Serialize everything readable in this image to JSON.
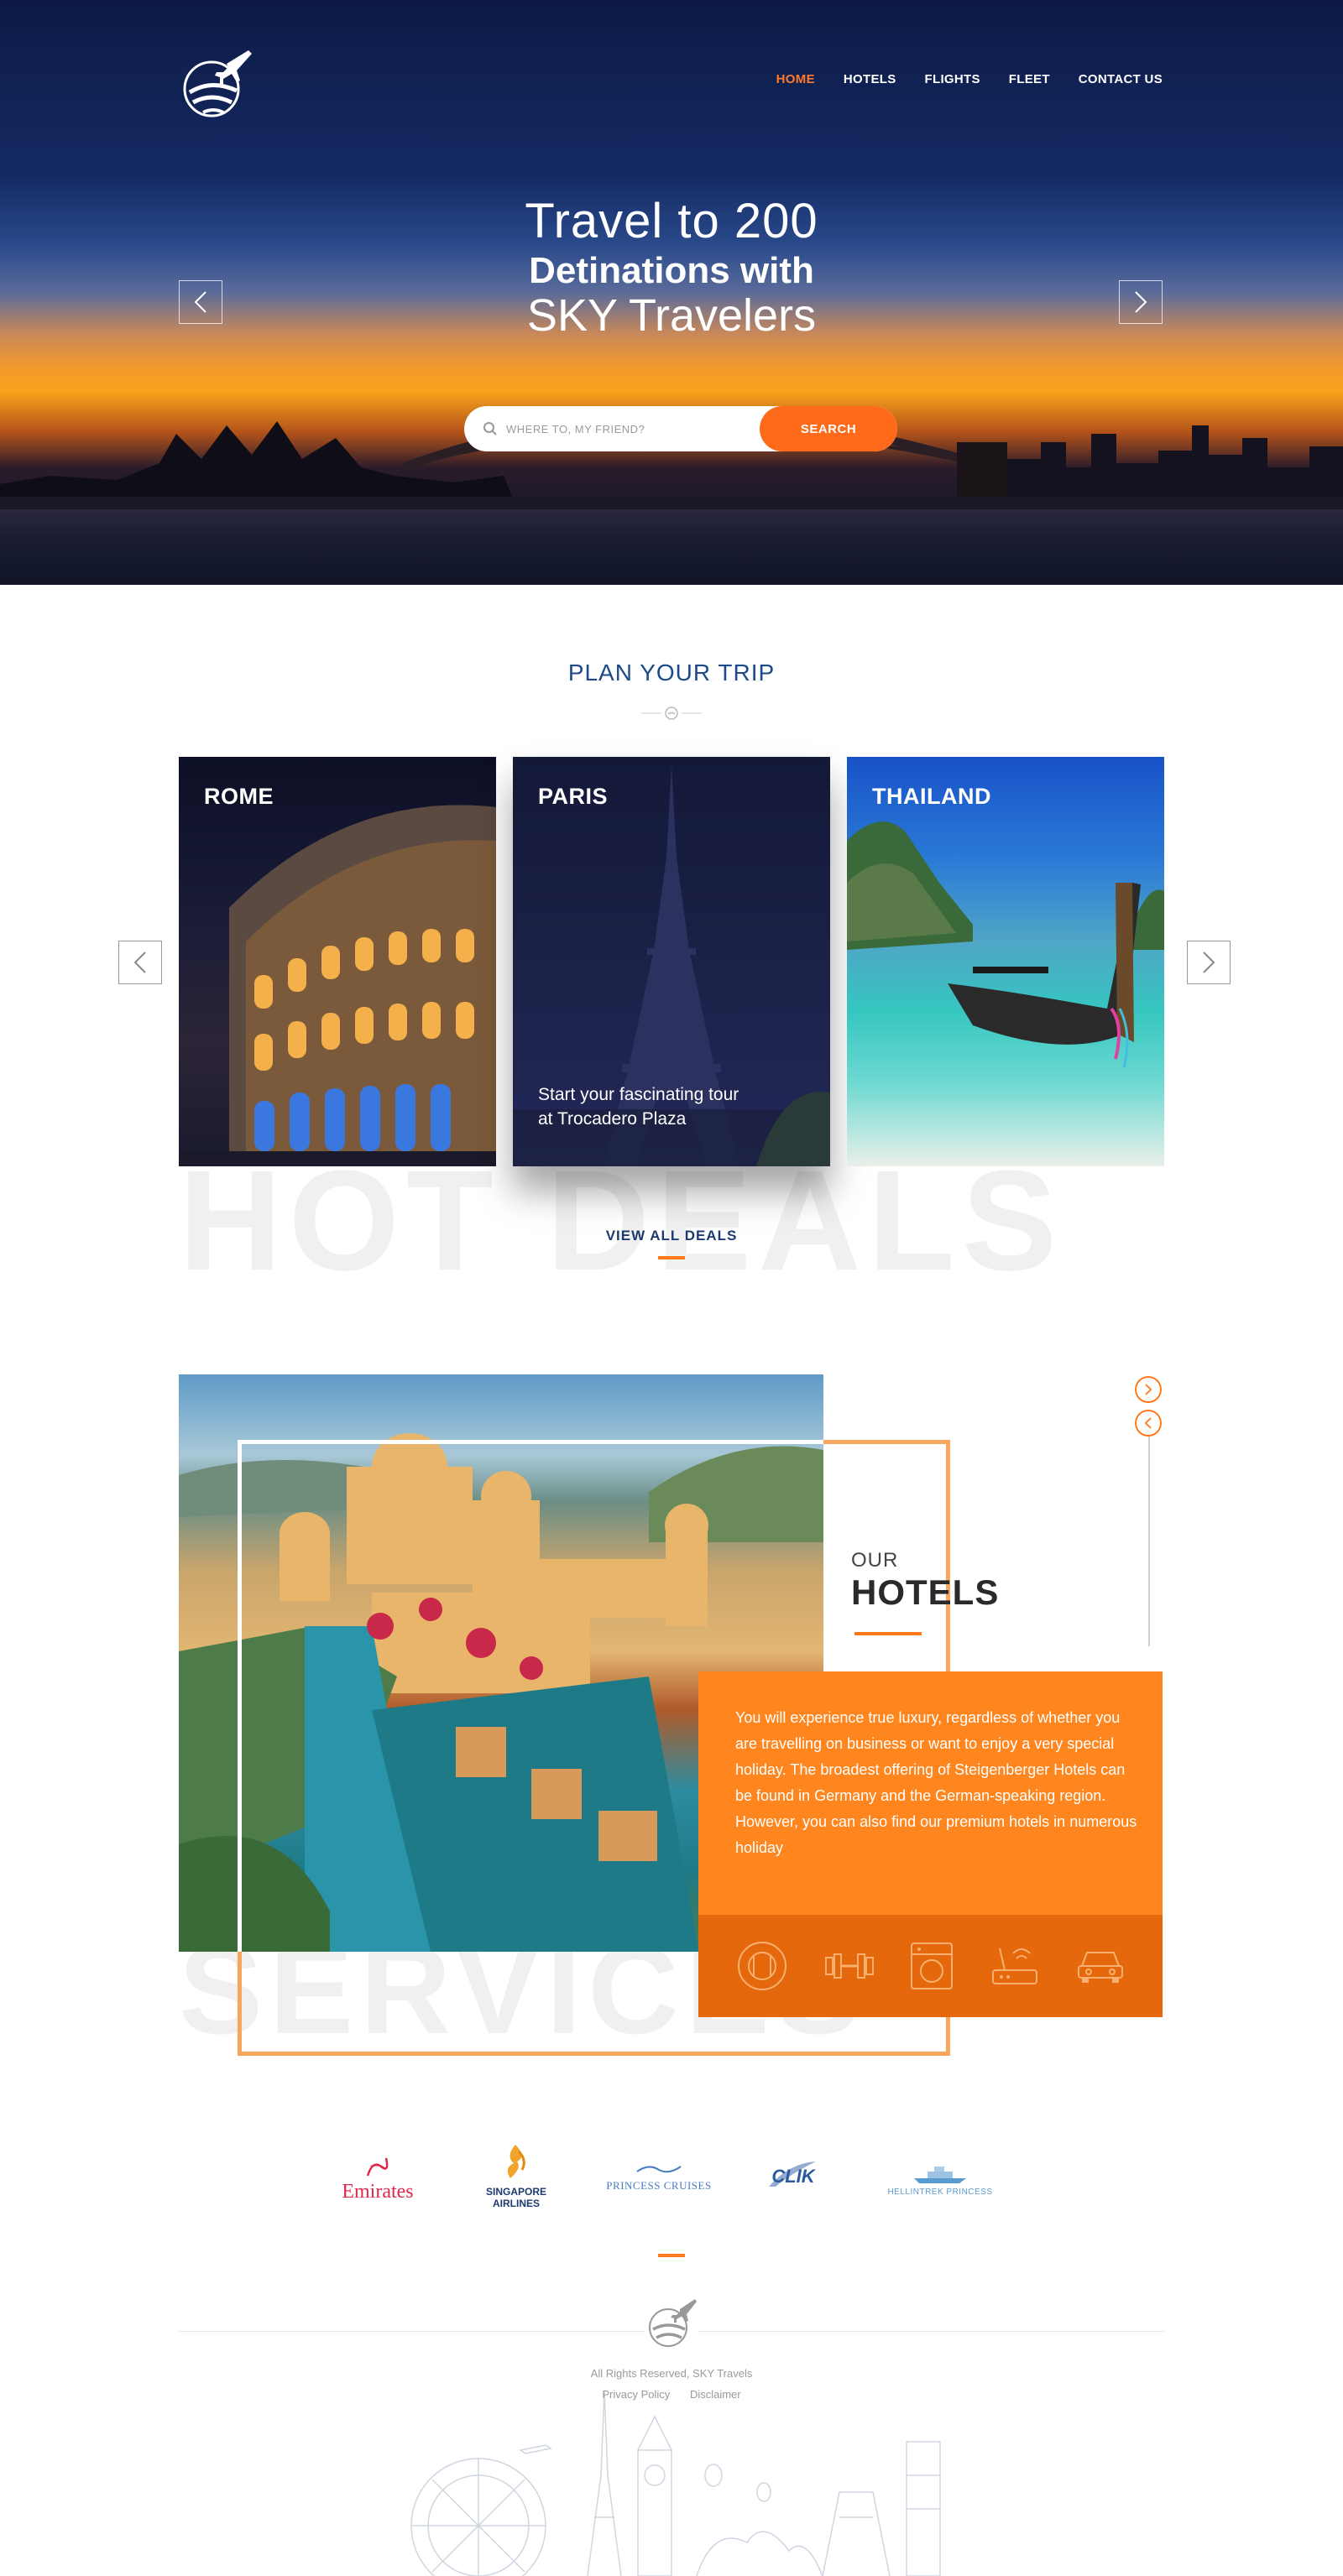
{
  "nav": {
    "items": [
      {
        "label": "HOME",
        "active": true
      },
      {
        "label": "HOTELS",
        "active": false
      },
      {
        "label": "FLIGHTS",
        "active": false
      },
      {
        "label": "FLEET",
        "active": false
      },
      {
        "label": "CONTACT US",
        "active": false
      }
    ]
  },
  "hero": {
    "line1": "Travel to 200",
    "line2": "Detinations with",
    "line3": "SKY Travelers",
    "search_placeholder": "WHERE TO, MY FRIEND?",
    "search_button": "SEARCH"
  },
  "plan": {
    "title": "PLAN YOUR TRIP",
    "cards": [
      {
        "name": "ROME",
        "desc": ""
      },
      {
        "name": "PARIS",
        "desc": "Start your fascinating tour at Trocadero Plaza"
      },
      {
        "name": "THAILAND",
        "desc": ""
      }
    ],
    "watermark": "HOT DEALS",
    "view_all": "VIEW ALL DEALS"
  },
  "hotels": {
    "our": "OUR",
    "title": "HOTELS",
    "description": "You will experience true luxury, regardless of whether you are travelling on business or want to enjoy a very special holiday. The broadest offering of Steigenberger Hotels can be found in Germany and the German-speaking region. However, you can also find our premium hotels in numerous holiday",
    "watermark": "SERVICES",
    "amenities": [
      "restaurant-icon",
      "gym-icon",
      "laundry-icon",
      "wifi-router-icon",
      "car-icon"
    ]
  },
  "partners": [
    {
      "name": "Emirates",
      "color": "#e0284a"
    },
    {
      "name": "SINGAPORE AIRLINES",
      "color": "#1d3a70"
    },
    {
      "name": "PRINCESS CRUISES",
      "color": "#4a7cc0"
    },
    {
      "name": "CLIK",
      "color": "#2a5aa0"
    },
    {
      "name": "HELLINTREK PRINCESS",
      "color": "#5a9bd0"
    }
  ],
  "footer": {
    "copyright": "All Rights Reserved, SKY Travels",
    "links": [
      "Privacy Policy",
      "Disclaimer"
    ]
  },
  "colors": {
    "accent": "#ff7a1a",
    "navy": "#1d4a8a"
  }
}
